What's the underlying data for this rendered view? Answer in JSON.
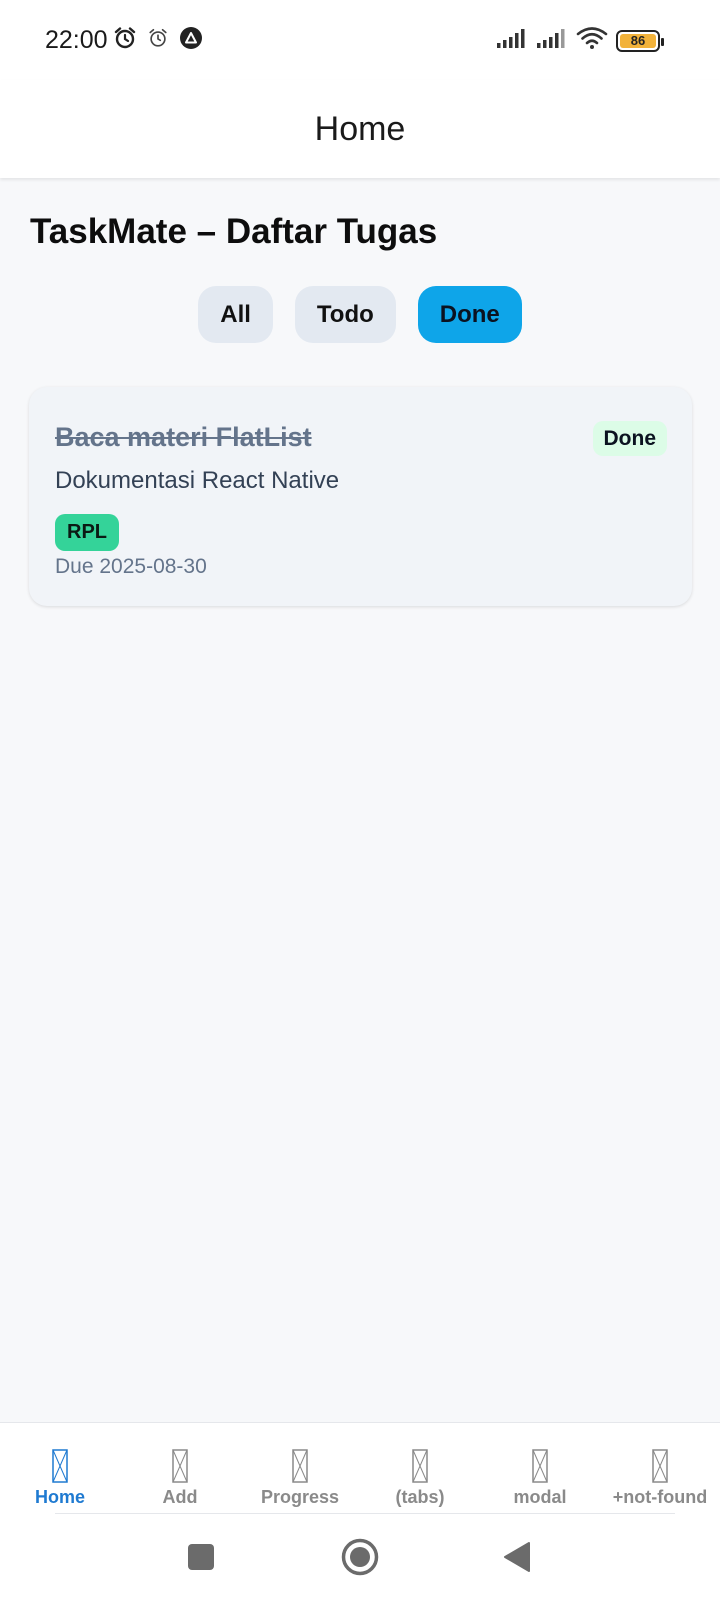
{
  "status_bar": {
    "time": "22:00",
    "icons_left": [
      "alarm-clock-icon",
      "alarm-icon",
      "app-logo-icon"
    ],
    "icons_right": [
      "signal-icon",
      "signal-icon",
      "wifi-icon"
    ],
    "battery": "86",
    "battery_color": "#f2b23a"
  },
  "header": {
    "title": "Home"
  },
  "main": {
    "title": "TaskMate – Daftar Tugas",
    "filters": [
      {
        "label": "All",
        "active": false
      },
      {
        "label": "Todo",
        "active": false
      },
      {
        "label": "Done",
        "active": true
      }
    ],
    "active_color": "#0ea5e9",
    "tasks": [
      {
        "title": "Baca materi FlatList",
        "description": "Dokumentasi React Native",
        "tag": "RPL",
        "tag_color": "#34d399",
        "due": "Due 2025-08-30",
        "status": "Done",
        "status_color": "#dcfce7"
      }
    ]
  },
  "tab_bar": {
    "items": [
      {
        "label": "Home",
        "icon": "missing-glyph-icon",
        "active": true
      },
      {
        "label": "Add",
        "icon": "missing-glyph-icon",
        "active": false
      },
      {
        "label": "Progress",
        "icon": "missing-glyph-icon",
        "active": false
      },
      {
        "label": "(tabs)",
        "icon": "missing-glyph-icon",
        "active": false
      },
      {
        "label": "modal",
        "icon": "missing-glyph-icon",
        "active": false
      },
      {
        "label": "+not-found",
        "icon": "missing-glyph-icon",
        "active": false
      }
    ],
    "active_color": "#1f7ad1"
  },
  "system_nav": {
    "buttons": [
      "recents-icon",
      "home-icon",
      "back-icon"
    ]
  }
}
